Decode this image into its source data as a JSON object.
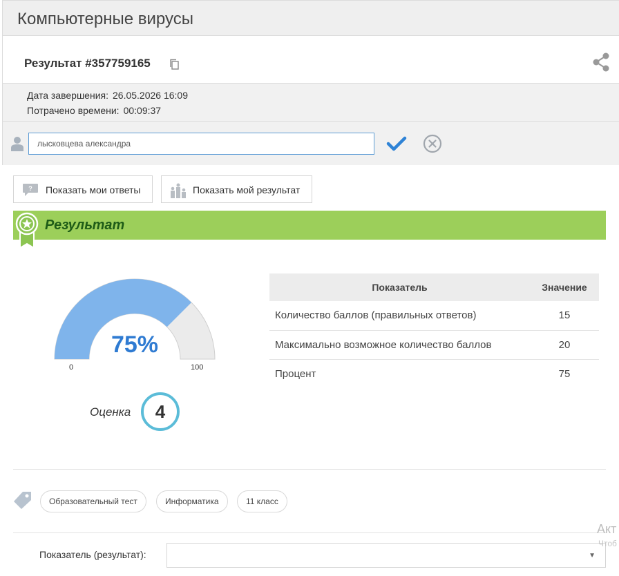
{
  "header": {
    "title": "Компьютерные вирусы"
  },
  "result": {
    "title": "Результат #357759165"
  },
  "meta": {
    "completed_label": "Дата завершения:",
    "completed_value": "26.05.2026 16:09",
    "time_label": "Потрачено времени:",
    "time_value": "00:09:37"
  },
  "name_input": {
    "value": "лысковцева александра"
  },
  "buttons": {
    "show_answers": "Показать мои ответы",
    "show_result": "Показать мой результат"
  },
  "result_banner": {
    "label": "Результат"
  },
  "gauge": {
    "percent_label": "75%",
    "percent": 75,
    "min": "0",
    "max": "100"
  },
  "grade": {
    "label": "Оценка",
    "value": "4"
  },
  "stats_table": {
    "headers": [
      "Показатель",
      "Значение"
    ],
    "rows": [
      [
        "Количество баллов (правильных ответов)",
        "15"
      ],
      [
        "Максимально возможное количество баллов",
        "20"
      ],
      [
        "Процент",
        "75"
      ]
    ]
  },
  "tags": [
    "Образовательный тест",
    "Информатика",
    "11 класс"
  ],
  "filter": {
    "label": "Показатель (результат):",
    "value": ""
  },
  "watermark": {
    "line1": "Акт",
    "line2": "Чтоб"
  },
  "colors": {
    "gauge_fill": "#7fb4eb",
    "gauge_rest": "#ebebeb",
    "banner": "#9ccf5a",
    "grade_ring": "#5bbcd8",
    "percent_text": "#2f7bd2"
  },
  "icons": [
    "copy-icon",
    "share-icon",
    "user-icon",
    "check-icon",
    "cancel-icon",
    "question-bubble-icon",
    "podium-icon",
    "award-ribbon-icon",
    "tag-icon",
    "dropdown-arrow-icon"
  ]
}
